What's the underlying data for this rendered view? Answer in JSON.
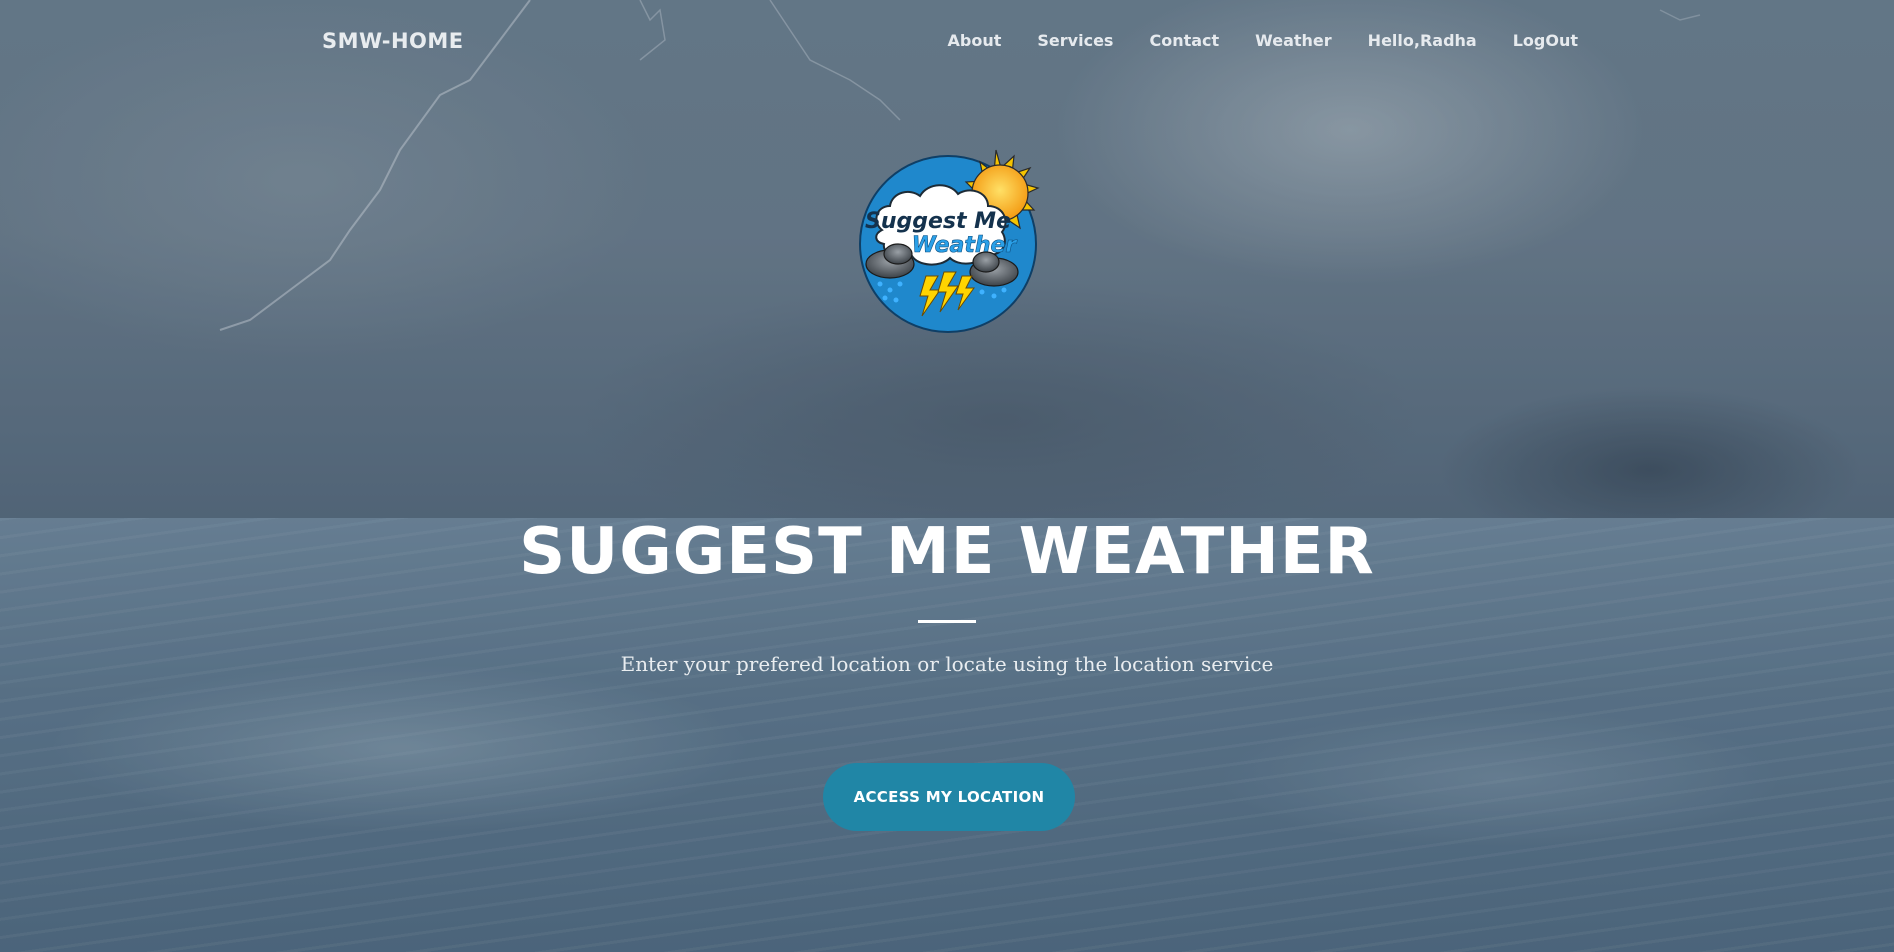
{
  "navbar": {
    "brand": "SMW-HOME",
    "links": [
      "About",
      "Services",
      "Contact",
      "Weather",
      "Hello,Radha",
      "LogOut"
    ]
  },
  "logo": {
    "line1": "Suggest Me",
    "line2": "Weather"
  },
  "hero": {
    "title": "SUGGEST ME WEATHER",
    "subtitle": "Enter your prefered location or locate using the location service",
    "button_label": "ACCESS MY LOCATION"
  },
  "colors": {
    "button": "#2086a6",
    "logo_circle": "#1f88cc",
    "sun": "#f5a623"
  }
}
